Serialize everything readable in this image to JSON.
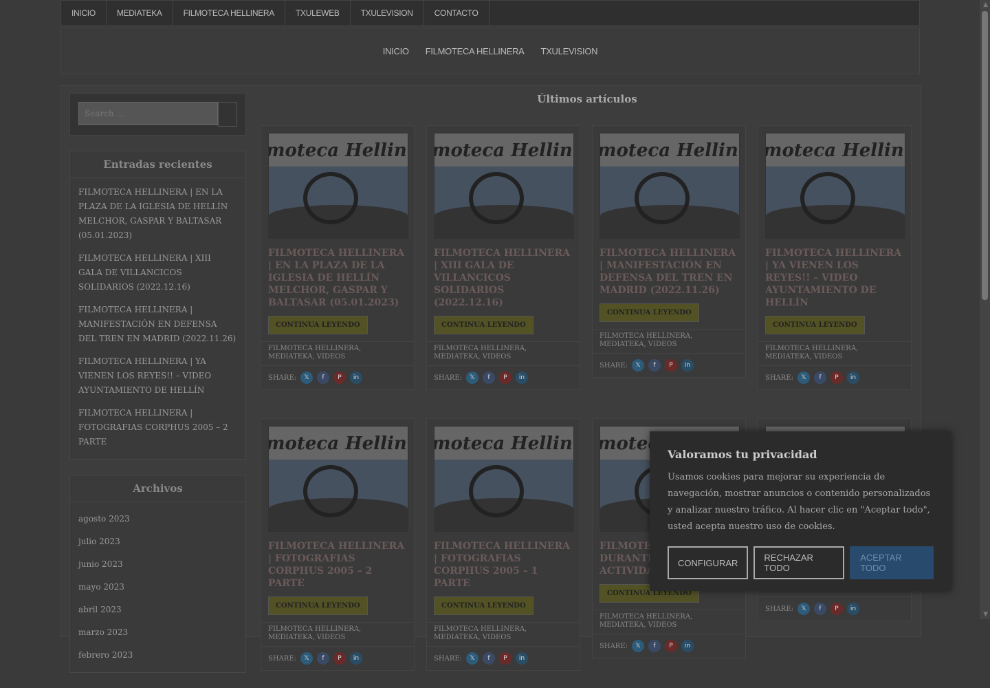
{
  "topnav": [
    "INICIO",
    "MEDIATEKA",
    "FILMOTECA HELLINERA",
    "TXULEWEB",
    "TXULEVISION",
    "CONTACTO"
  ],
  "header_nav": [
    "INICIO",
    "FILMOTECA HELLINERA",
    "TXULEVISION"
  ],
  "search": {
    "placeholder": "Search ..."
  },
  "recent": {
    "title": "Entradas recientes",
    "items": [
      "FILMOTECA HELLINERA | EN LA PLAZA DE LA IGLESIA DE HELLÍN MELCHOR, GASPAR Y BALTASAR (05.01.2023)",
      "FILMOTECA HELLINERA | XIII GALA DE VILLANCICOS SOLIDARIOS (2022.12.16)",
      "FILMOTECA HELLINERA | MANIFESTACIÓN EN DEFENSA DEL TREN EN MADRID (2022.11.26)",
      "FILMOTECA HELLINERA | YA VIENEN LOS REYES!! – VIDEO AYUNTAMIENTO DE HELLÍN",
      "FILMOTECA HELLINERA | FOTOGRAFIAS CORPHUS 2005 – 2 PARTE"
    ]
  },
  "archives": {
    "title": "Archivos",
    "items": [
      "agosto 2023",
      "julio 2023",
      "junio 2023",
      "mayo 2023",
      "abril 2023",
      "marzo 2023",
      "febrero 2023"
    ]
  },
  "content": {
    "heading": "Últimos artículos",
    "read_more": "CONTINUA LEYENDO",
    "share_label": "SHARE:",
    "categories": "FILMOTECA HELLINERA, MEDIATEKA, VIDEOS",
    "thumb_text": "moteca Hellin",
    "cards": [
      {
        "title": "FILMOTECA HELLINERA | EN LA PLAZA DE LA IGLESIA DE HELLÍN MELCHOR, GASPAR Y BALTASAR (05.01.2023)"
      },
      {
        "title": "FILMOTECA HELLINERA | XIII GALA DE VILLANCICOS SOLIDARIOS (2022.12.16)"
      },
      {
        "title": "FILMOTECA HELLINERA | MANIFESTACIÓN EN DEFENSA DEL TREN EN MADRID (2022.11.26)"
      },
      {
        "title": "FILMOTECA HELLINERA | YA VIENEN LOS REYES!! – VIDEO AYUNTAMIENTO DE HELLÍN"
      },
      {
        "title": "FILMOTECA HELLINERA | FOTOGRAFIAS CORPHUS 2005 – 2 PARTE"
      },
      {
        "title": "FILMOTECA HELLINERA | FOTOGRAFIAS CORPHUS 2005 – 1 PARTE"
      },
      {
        "title": "FILMOTECA CASTILLO DURANTE FINALIZAC ACTIVIDAD SUEÑA"
      },
      {
        "title": ""
      }
    ]
  },
  "share_colors": {
    "x": "#2d5b7a",
    "facebook": "#3a4a66",
    "pinterest": "#6b2a2a",
    "linkedin": "#2a4d66"
  },
  "cookie": {
    "title": "Valoramos tu privacidad",
    "text": "Usamos cookies para mejorar su experiencia de navegación, mostrar anuncios o contenido personalizados y analizar nuestro tráfico. Al hacer clic en \"Aceptar todo\", usted acepta nuestro uso de cookies.",
    "configure": "CONFIGURAR",
    "reject": "RECHAZAR TODO",
    "accept": "ACEPTAR TODO"
  }
}
